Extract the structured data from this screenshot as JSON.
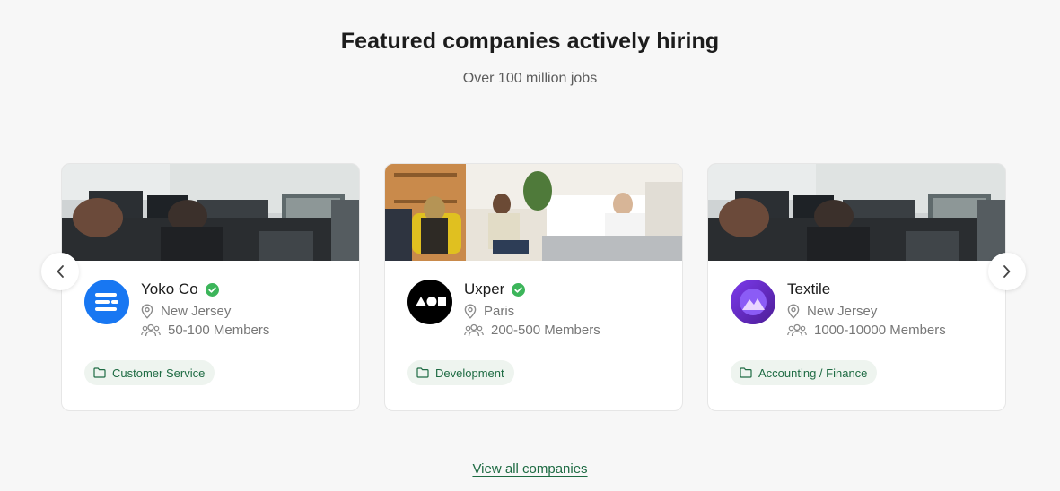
{
  "header": {
    "title": "Featured companies actively hiring",
    "subtitle": "Over 100 million jobs"
  },
  "carousel": {
    "prev_icon": "chevron-left-icon",
    "next_icon": "chevron-right-icon",
    "cards": [
      {
        "name": "Yoko Co",
        "location": "New Jersey",
        "members": "50-100 Members",
        "category": "Customer Service",
        "logo_color": "#1877f2",
        "verified": true
      },
      {
        "name": "Uxper",
        "location": "Paris",
        "members": "200-500 Members",
        "category": "Development",
        "logo_color": "#000000",
        "verified": true
      },
      {
        "name": "Textile",
        "location": "New Jersey",
        "members": "1000-10000 Members",
        "category": "Accounting / Finance",
        "logo_color": "#6d28d9",
        "verified": false
      }
    ]
  },
  "footer": {
    "view_all_label": "View all companies"
  },
  "colors": {
    "accent": "#1e6b43",
    "tag_bg": "#eef4ef",
    "verified_green": "#3cb55a"
  }
}
